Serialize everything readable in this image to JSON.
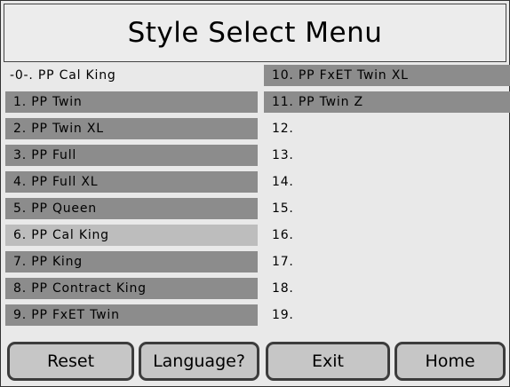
{
  "title": "Style Select Menu",
  "left_column": [
    {
      "label": "-0-. PP Cal King",
      "style": "plain"
    },
    {
      "label": "1. PP Twin",
      "style": "item"
    },
    {
      "label": "2. PP Twin XL",
      "style": "item"
    },
    {
      "label": "3. PP Full",
      "style": "item"
    },
    {
      "label": "4. PP Full XL",
      "style": "item"
    },
    {
      "label": "5. PP Queen",
      "style": "item"
    },
    {
      "label": "6. PP Cal King",
      "style": "selected"
    },
    {
      "label": "7. PP King",
      "style": "item"
    },
    {
      "label": "8. PP Contract King",
      "style": "item"
    },
    {
      "label": "9. PP FxET Twin",
      "style": "item"
    }
  ],
  "right_column": [
    {
      "label": "10. PP FxET Twin XL",
      "style": "item"
    },
    {
      "label": "11. PP Twin Z",
      "style": "item"
    },
    {
      "label": "12.",
      "style": "plain"
    },
    {
      "label": "13.",
      "style": "plain"
    },
    {
      "label": "14.",
      "style": "plain"
    },
    {
      "label": "15.",
      "style": "plain"
    },
    {
      "label": "16.",
      "style": "plain"
    },
    {
      "label": "17.",
      "style": "plain"
    },
    {
      "label": "18.",
      "style": "plain"
    },
    {
      "label": "19.",
      "style": "plain"
    }
  ],
  "buttons": {
    "reset": "Reset",
    "language": "Language?",
    "exit": "Exit",
    "home": "Home"
  },
  "colors": {
    "item_background": "#8c8c8c",
    "selected_background": "#bdbdbd",
    "screen_background": "#e9e9e9"
  }
}
